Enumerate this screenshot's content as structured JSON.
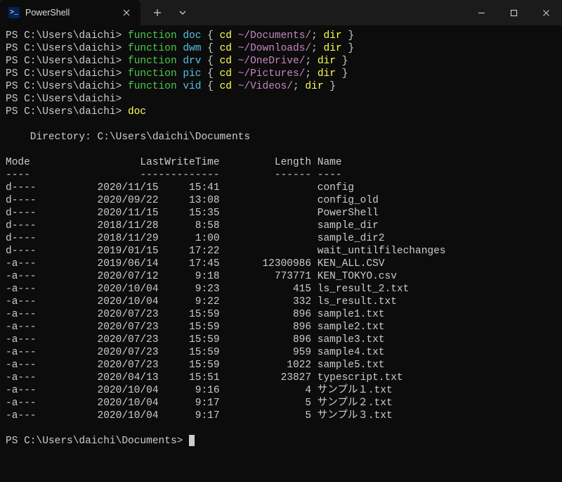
{
  "titlebar": {
    "tab_title": "PowerShell",
    "tab_icon_glyph": ">_"
  },
  "session": {
    "prompt_main": "PS C:\\Users\\daichi>",
    "prompt_docs": "PS C:\\Users\\daichi\\Documents>",
    "functions": [
      {
        "name": "doc",
        "path": "~/Documents/"
      },
      {
        "name": "dwm",
        "path": "~/Downloads/"
      },
      {
        "name": "drv",
        "path": "~/OneDrive/"
      },
      {
        "name": "pic",
        "path": "~/Pictures/"
      },
      {
        "name": "vid",
        "path": "~/Videos/"
      }
    ],
    "keyword_function": "function",
    "keyword_cd": "cd",
    "keyword_dir": "dir",
    "invoke_cmd": "doc"
  },
  "listing": {
    "directory_label": "    Directory: C:\\Users\\daichi\\Documents",
    "headers": {
      "mode": "Mode",
      "lastwrite": "LastWriteTime",
      "length": "Length",
      "name": "Name"
    },
    "underlines": {
      "mode": "----",
      "lastwrite": "-------------",
      "length": "------",
      "name": "----"
    },
    "rows": [
      {
        "mode": "d----",
        "date": "2020/11/15",
        "time": "15:41",
        "length": "",
        "name": "config"
      },
      {
        "mode": "d----",
        "date": "2020/09/22",
        "time": "13:08",
        "length": "",
        "name": "config_old"
      },
      {
        "mode": "d----",
        "date": "2020/11/15",
        "time": "15:35",
        "length": "",
        "name": "PowerShell"
      },
      {
        "mode": "d----",
        "date": "2018/11/28",
        "time": "8:58",
        "length": "",
        "name": "sample_dir"
      },
      {
        "mode": "d----",
        "date": "2018/11/29",
        "time": "1:00",
        "length": "",
        "name": "sample_dir2"
      },
      {
        "mode": "d----",
        "date": "2019/01/15",
        "time": "17:22",
        "length": "",
        "name": "wait_untilfilechanges"
      },
      {
        "mode": "-a---",
        "date": "2019/06/14",
        "time": "17:45",
        "length": "12300986",
        "name": "KEN_ALL.CSV"
      },
      {
        "mode": "-a---",
        "date": "2020/07/12",
        "time": "9:18",
        "length": "773771",
        "name": "KEN_TOKYO.csv"
      },
      {
        "mode": "-a---",
        "date": "2020/10/04",
        "time": "9:23",
        "length": "415",
        "name": "ls_result_2.txt"
      },
      {
        "mode": "-a---",
        "date": "2020/10/04",
        "time": "9:22",
        "length": "332",
        "name": "ls_result.txt"
      },
      {
        "mode": "-a---",
        "date": "2020/07/23",
        "time": "15:59",
        "length": "896",
        "name": "sample1.txt"
      },
      {
        "mode": "-a---",
        "date": "2020/07/23",
        "time": "15:59",
        "length": "896",
        "name": "sample2.txt"
      },
      {
        "mode": "-a---",
        "date": "2020/07/23",
        "time": "15:59",
        "length": "896",
        "name": "sample3.txt"
      },
      {
        "mode": "-a---",
        "date": "2020/07/23",
        "time": "15:59",
        "length": "959",
        "name": "sample4.txt"
      },
      {
        "mode": "-a---",
        "date": "2020/07/23",
        "time": "15:59",
        "length": "1022",
        "name": "sample5.txt"
      },
      {
        "mode": "-a---",
        "date": "2020/04/13",
        "time": "15:51",
        "length": "23827",
        "name": "typescript.txt"
      },
      {
        "mode": "-a---",
        "date": "2020/10/04",
        "time": "9:16",
        "length": "4",
        "name": "サンプル１.txt"
      },
      {
        "mode": "-a---",
        "date": "2020/10/04",
        "time": "9:17",
        "length": "5",
        "name": "サンプル２.txt"
      },
      {
        "mode": "-a---",
        "date": "2020/10/04",
        "time": "9:17",
        "length": "5",
        "name": "サンプル３.txt"
      }
    ]
  }
}
